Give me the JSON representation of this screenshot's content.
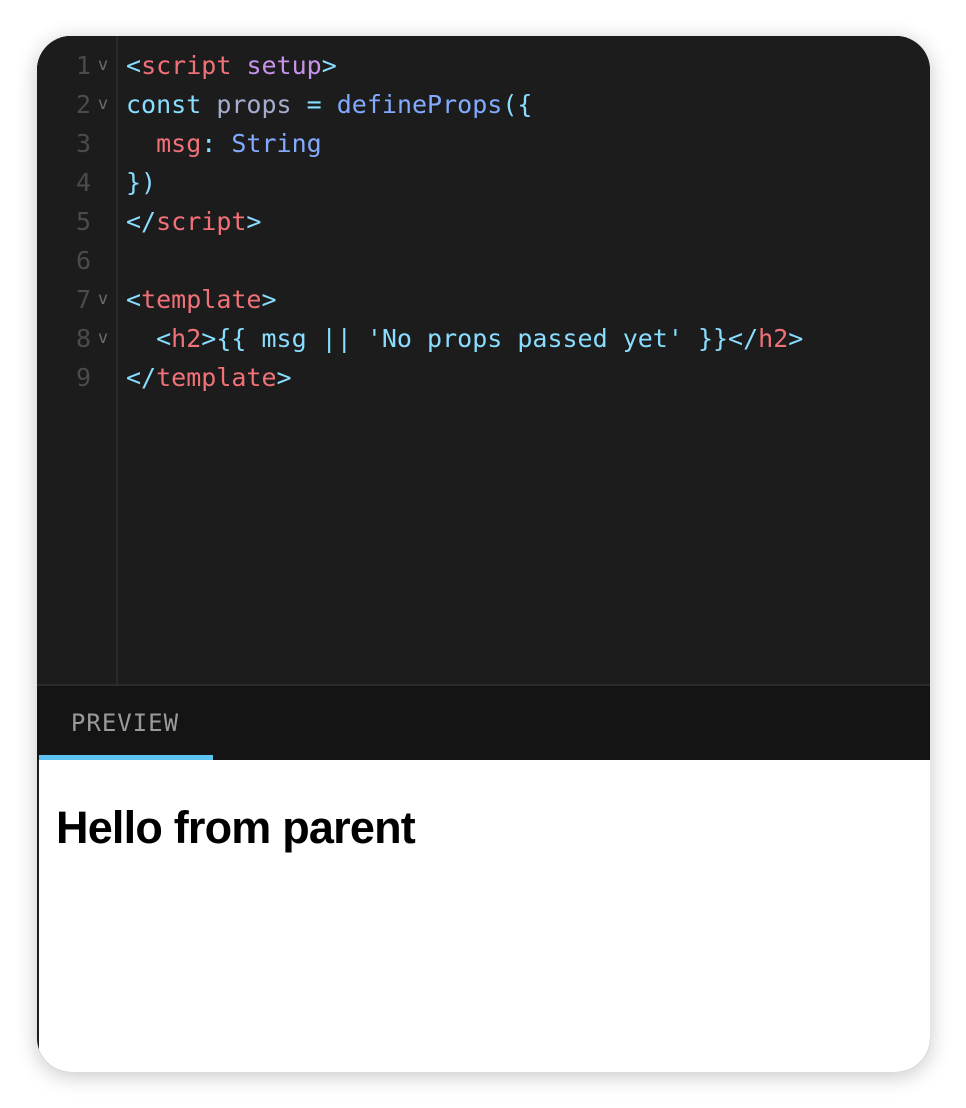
{
  "editor": {
    "line_numbers": [
      "1",
      "2",
      "3",
      "4",
      "5",
      "6",
      "7",
      "8",
      "9"
    ],
    "fold_marker": "v",
    "lines": [
      [
        {
          "t": "<",
          "c": "#89ddff"
        },
        {
          "t": "script",
          "c": "#f07178"
        },
        {
          "t": " ",
          "c": "#89ddff"
        },
        {
          "t": "setup",
          "c": "#c792ea"
        },
        {
          "t": ">",
          "c": "#89ddff"
        }
      ],
      [
        {
          "t": "const",
          "c": "#89ddff"
        },
        {
          "t": " props ",
          "c": "#a6accd"
        },
        {
          "t": "=",
          "c": "#89ddff"
        },
        {
          "t": " defineProps",
          "c": "#82aaff"
        },
        {
          "t": "({",
          "c": "#89ddff"
        }
      ],
      [
        {
          "t": "  msg",
          "c": "#f07178"
        },
        {
          "t": ": ",
          "c": "#89ddff"
        },
        {
          "t": "String",
          "c": "#82aaff"
        }
      ],
      [
        {
          "t": "})",
          "c": "#89ddff"
        }
      ],
      [
        {
          "t": "</",
          "c": "#89ddff"
        },
        {
          "t": "script",
          "c": "#f07178"
        },
        {
          "t": ">",
          "c": "#89ddff"
        }
      ],
      [],
      [
        {
          "t": "<",
          "c": "#89ddff"
        },
        {
          "t": "template",
          "c": "#f07178"
        },
        {
          "t": ">",
          "c": "#89ddff"
        }
      ],
      [
        {
          "t": "  <",
          "c": "#89ddff"
        },
        {
          "t": "h2",
          "c": "#f07178"
        },
        {
          "t": ">{{ msg || 'No props passed yet' }}</",
          "c": "#89ddff"
        },
        {
          "t": "h2",
          "c": "#f07178"
        },
        {
          "t": ">",
          "c": "#89ddff"
        }
      ],
      [
        {
          "t": "</",
          "c": "#89ddff"
        },
        {
          "t": "template",
          "c": "#f07178"
        },
        {
          "t": ">",
          "c": "#89ddff"
        }
      ]
    ],
    "foldable_lines": [
      1,
      2,
      7,
      8
    ]
  },
  "tabs": {
    "preview_label": "PREVIEW",
    "active_color": "#5cc2f2"
  },
  "preview": {
    "heading": "Hello from parent"
  },
  "colors": {
    "editor_bg": "#1c1c1c",
    "tabbar_bg": "#141414",
    "line_number": "#4b4b4b"
  }
}
